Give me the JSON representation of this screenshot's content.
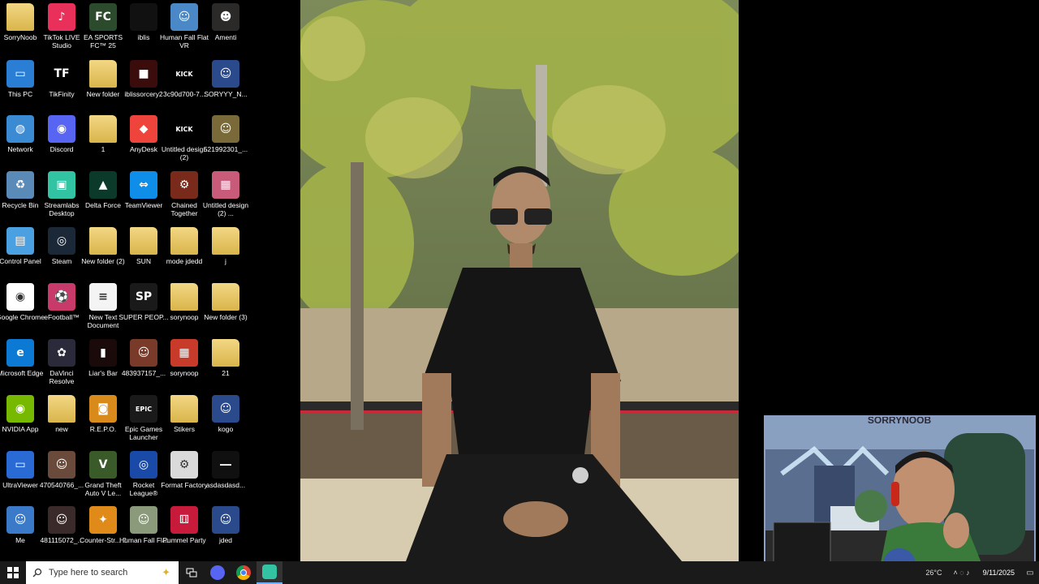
{
  "desktop": {
    "icons": [
      {
        "label": "SorryNoob",
        "kind": "folder",
        "bg": "#e2c064"
      },
      {
        "label": "TikTok LIVE Studio",
        "kind": "app",
        "bg": "#e8305a",
        "glyph": "♪"
      },
      {
        "label": "EA SPORTS FC™ 25",
        "kind": "app",
        "bg": "#2c4a2c",
        "glyph": "FC"
      },
      {
        "label": "iblis",
        "kind": "app",
        "bg": "#111111",
        "glyph": ""
      },
      {
        "label": "Human Fall Flat VR",
        "kind": "app",
        "bg": "#4a88c8",
        "glyph": "☺"
      },
      {
        "label": "Amenti",
        "kind": "app",
        "bg": "#2c2a28",
        "glyph": "☻"
      },
      {
        "label": "This PC",
        "kind": "app",
        "bg": "#2a7fd4",
        "glyph": "▭"
      },
      {
        "label": "TikFinity",
        "kind": "app",
        "bg": "#000000",
        "glyph": "TF"
      },
      {
        "label": "New folder",
        "kind": "folder",
        "bg": "#e2c064"
      },
      {
        "label": "iblissorcery2",
        "kind": "app",
        "bg": "#3a0c0c",
        "glyph": "■"
      },
      {
        "label": "3c90d700-7...",
        "kind": "app",
        "bg": "#000000",
        "glyph": "KICK"
      },
      {
        "label": "SORYYY_N...",
        "kind": "app",
        "bg": "#2a4a8c",
        "glyph": "☺"
      },
      {
        "label": "Network",
        "kind": "app",
        "bg": "#3a8ad4",
        "glyph": "◍"
      },
      {
        "label": "Discord",
        "kind": "app",
        "bg": "#5865f2",
        "glyph": "◉"
      },
      {
        "label": "1",
        "kind": "folder",
        "bg": "#e2c064"
      },
      {
        "label": "AnyDesk",
        "kind": "app",
        "bg": "#ef443b",
        "glyph": "◆"
      },
      {
        "label": "Untitled design (2)",
        "kind": "app",
        "bg": "#000000",
        "glyph": "KICK"
      },
      {
        "label": "521992301_...",
        "kind": "app",
        "bg": "#7a6a3a",
        "glyph": "☺"
      },
      {
        "label": "Recycle Bin",
        "kind": "app",
        "bg": "#5a8ab8",
        "glyph": "♻"
      },
      {
        "label": "Streamlabs Desktop",
        "kind": "app",
        "bg": "#31c3a2",
        "glyph": "▣"
      },
      {
        "label": "Delta Force",
        "kind": "app",
        "bg": "#0c3a2a",
        "glyph": "▲"
      },
      {
        "label": "TeamViewer",
        "kind": "app",
        "bg": "#0e8ee9",
        "glyph": "⇔"
      },
      {
        "label": "Chained Together",
        "kind": "app",
        "bg": "#7a2a1a",
        "glyph": "⚙"
      },
      {
        "label": "Untitled design (2) ...",
        "kind": "app",
        "bg": "#c85a7a",
        "glyph": "▦"
      },
      {
        "label": "Control Panel",
        "kind": "app",
        "bg": "#4aa0e0",
        "glyph": "▤"
      },
      {
        "label": "Steam",
        "kind": "app",
        "bg": "#1b2838",
        "glyph": "◎"
      },
      {
        "label": "New folder (2)",
        "kind": "folder",
        "bg": "#e2c064"
      },
      {
        "label": "SUN",
        "kind": "folder",
        "bg": "#e2c064"
      },
      {
        "label": "mode jdedd",
        "kind": "folder",
        "bg": "#e2c064"
      },
      {
        "label": "j",
        "kind": "folder",
        "bg": "#e2c064"
      },
      {
        "label": "Google Chrome",
        "kind": "app",
        "bg": "#ffffff",
        "glyph": "◉"
      },
      {
        "label": "eFootball™",
        "kind": "app",
        "bg": "#c83a6a",
        "glyph": "⚽"
      },
      {
        "label": "New Text Document",
        "kind": "app",
        "bg": "#f4f4f4",
        "glyph": "≡"
      },
      {
        "label": "SUPER PEOP...",
        "kind": "app",
        "bg": "#1a1a1a",
        "glyph": "SP"
      },
      {
        "label": "sorynoop",
        "kind": "folder",
        "bg": "#f2dc8a"
      },
      {
        "label": "New folder (3)",
        "kind": "folder",
        "bg": "#e2c064"
      },
      {
        "label": "Microsoft Edge",
        "kind": "app",
        "bg": "#0c7ad4",
        "glyph": "e"
      },
      {
        "label": "DaVinci Resolve",
        "kind": "app",
        "bg": "#2a2a3a",
        "glyph": "✿"
      },
      {
        "label": "Liar's Bar",
        "kind": "app",
        "bg": "#1a0a0a",
        "glyph": "▮"
      },
      {
        "label": "483937157_...",
        "kind": "app",
        "bg": "#7a3a2a",
        "glyph": "☺"
      },
      {
        "label": "sorynoop",
        "kind": "app",
        "bg": "#c83a2a",
        "glyph": "▦"
      },
      {
        "label": "21",
        "kind": "folder",
        "bg": "#e2c064"
      },
      {
        "label": "NVIDIA App",
        "kind": "app",
        "bg": "#76b900",
        "glyph": "◉"
      },
      {
        "label": "new",
        "kind": "folder",
        "bg": "#e2c064"
      },
      {
        "label": "R.E.P.O.",
        "kind": "app",
        "bg": "#d88a1a",
        "glyph": "◙"
      },
      {
        "label": "Epic Games Launcher",
        "kind": "app",
        "bg": "#1a1a1a",
        "glyph": "EPIC"
      },
      {
        "label": "Stikers",
        "kind": "folder",
        "bg": "#e2c064"
      },
      {
        "label": "kogo",
        "kind": "app",
        "bg": "#2a4a8c",
        "glyph": "☺"
      },
      {
        "label": "UltraViewer",
        "kind": "app",
        "bg": "#2a6ad4",
        "glyph": "▭"
      },
      {
        "label": "470540766_...",
        "kind": "app",
        "bg": "#6a4a3a",
        "glyph": "☺"
      },
      {
        "label": "Grand Theft Auto V Le...",
        "kind": "app",
        "bg": "#3a5a2a",
        "glyph": "V"
      },
      {
        "label": "Rocket League®",
        "kind": "app",
        "bg": "#1a4aa8",
        "glyph": "◎"
      },
      {
        "label": "Format Factory",
        "kind": "app",
        "bg": "#dadada",
        "glyph": "⚙"
      },
      {
        "label": "asdasdasd...",
        "kind": "app",
        "bg": "#101010",
        "glyph": "―"
      },
      {
        "label": "Me",
        "kind": "app",
        "bg": "#3a7ac8",
        "glyph": "☺"
      },
      {
        "label": "481115072_...",
        "kind": "app",
        "bg": "#3a2a2a",
        "glyph": "☺"
      },
      {
        "label": "Counter-Str... 2",
        "kind": "app",
        "bg": "#e08a1a",
        "glyph": "✦"
      },
      {
        "label": "Human Fall Flat",
        "kind": "app",
        "bg": "#8a9a7a",
        "glyph": "☺"
      },
      {
        "label": "Pummel Party",
        "kind": "app",
        "bg": "#c81a3a",
        "glyph": "⚅"
      },
      {
        "label": "jded",
        "kind": "app",
        "bg": "#2a4a8c",
        "glyph": "☺"
      }
    ]
  },
  "photo_viewer": {
    "alt": "Photo of a man in black clothing with sunglasses sitting in front of a tree"
  },
  "webcam": {
    "overlay_text": "SORRYNOOB"
  },
  "taskbar": {
    "search_placeholder": "Type here to search",
    "clock_date": "9/11/2025",
    "temperature": "26°C",
    "apps": [
      "task-view",
      "discord",
      "chrome",
      "streamlabs"
    ]
  },
  "colors": {
    "taskbar_bg": "#1a1a1a",
    "desktop_bg": "#000000",
    "webcam_border": "#8fa0c8"
  }
}
